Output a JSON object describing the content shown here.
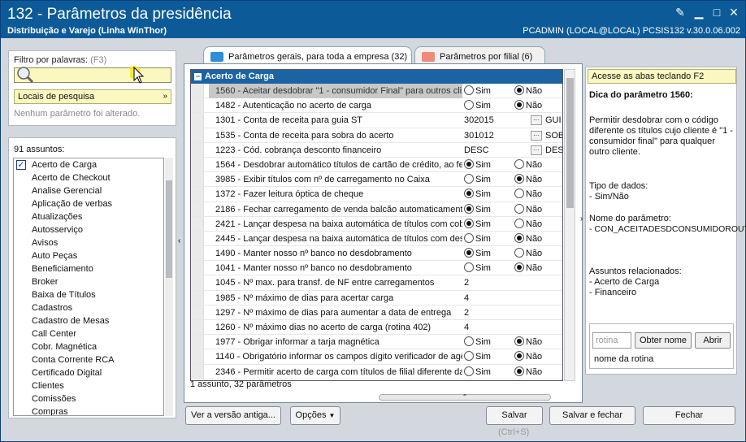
{
  "window": {
    "title": "132 - Parâmetros da presidência",
    "subtitle": "Distribuição e Varejo (Linha WinThor)",
    "userinfo": "PCADMIN (LOCAL@LOCAL)   PCSIS132  v.30.0.06.002"
  },
  "filter": {
    "label": "Filtro por palavras:",
    "hint": "(F3)",
    "search_value": "",
    "locais_label": "Locais de pesquisa",
    "no_change": "Nenhum parâmetro foi alterado."
  },
  "subjects": {
    "count_label": "91 assuntos:",
    "items": [
      "Acerto de Carga",
      "Acerto de Checkout",
      "Analise Gerencial",
      "Aplicação de verbas",
      "Atualizações",
      "Autosserviço",
      "Avisos",
      "Auto Peças",
      "Beneficiamento",
      "Broker",
      "Baixa de Títulos",
      "Cadastros",
      "Cadastro de Mesas",
      "Call Center",
      "Cobr. Magnética",
      "Conta Corrente RCA",
      "Certificado Digital",
      "Clientes",
      "Comissões",
      "Compras"
    ]
  },
  "tabs": {
    "general": "Parâmetros gerais, para toda a empresa  (32)",
    "branch": "Parâmetros por filial  (6)"
  },
  "grid": {
    "group": "Acerto de Carga",
    "rows": [
      {
        "label": "1560 - Aceitar desdobrar \"1 - consumidor Final\" para outros cli",
        "type": "radio",
        "value": "Não",
        "sel": true
      },
      {
        "label": "1482 - Autenticação no acerto de carga",
        "type": "radio",
        "value": "Não"
      },
      {
        "label": "1301 - Conta de receita para guia ST",
        "type": "lookup",
        "code": "302015",
        "desc": "GUI"
      },
      {
        "label": "1535 - Conta de receita para sobra do acerto",
        "type": "lookup",
        "code": "301012",
        "desc": "SOB"
      },
      {
        "label": "1223 - Cód. cobrança desconto financeiro",
        "type": "lookup",
        "code": "DESC",
        "desc": "DES"
      },
      {
        "label": "1564 - Desdobrar automático títulos de cartão de crédito, ao fe",
        "type": "radio",
        "value": "Sim"
      },
      {
        "label": "3985 - Exibir títulos com nº de carregamento no Caixa",
        "type": "radio",
        "value": "Não"
      },
      {
        "label": "1372 - Fazer leitura óptica de cheque",
        "type": "radio",
        "value": "Sim"
      },
      {
        "label": "2186 - Fechar carregamento de venda balcão automaticamente",
        "type": "radio",
        "value": "Sim"
      },
      {
        "label": "2421 - Lançar despesa na baixa automática de títulos com cobra",
        "type": "radio",
        "value": "Sim"
      },
      {
        "label": "2445 - Lançar despesa na baixa automática de títulos com desc",
        "type": "radio",
        "value": "Não"
      },
      {
        "label": "1490 - Manter nosso nº banco no desdobramento",
        "type": "radio",
        "value": "Sim"
      },
      {
        "label": "1041 - Manter nosso nº banco no desdobramento",
        "type": "radio",
        "value": "Não"
      },
      {
        "label": "1045 - Nº max. para transf. de NF entre carregamentos",
        "type": "text",
        "value": "2"
      },
      {
        "label": "1985 - Nº máximo de dias para acertar carga",
        "type": "text",
        "value": "4"
      },
      {
        "label": "1297 - Nº máximo de dias para aumentar a data de entrega",
        "type": "text",
        "value": "2"
      },
      {
        "label": "1260 - Nº máximo dias no acerto de carga (rotina 402)",
        "type": "text",
        "value": "4"
      },
      {
        "label": "1977 - Obrigar informar a tarja magnética",
        "type": "radio",
        "value": "Não"
      },
      {
        "label": "1140 - Obrigatório informar os campos dígito verificador de agê",
        "type": "radio",
        "value": "Não"
      },
      {
        "label": "2346 - Permitir acerto de carga com títulos de filial diferente da",
        "type": "radio",
        "value": "Não"
      }
    ],
    "yes": "Sim",
    "no": "Não",
    "status": "1 assunto, 32 parâmetros"
  },
  "tip": {
    "shortcut": "Acesse as abas teclando F2",
    "title": "Dica do parâmetro 1560:",
    "desc": "Permitir desdobrar com o código diferente os títulos cujo cliente é \"1 - consumidor final\" para qualquer outro cliente.",
    "type_label": "Tipo de dados:",
    "type_value": " - Sim/Não",
    "name_label": "Nome do parâmetro:",
    "name_value": " - CON_ACEITADESDCONSUMIDOROUT",
    "related_label": "Assuntos relacionados:",
    "related": [
      " - Acerto de Carga",
      " - Financeiro"
    ],
    "rotina_placeholder": "rotina",
    "obter_nome": "Obter nome",
    "abrir": "Abrir",
    "rotina_label": "nome da rotina"
  },
  "buttons": {
    "old_version": "Ver a versão antiga...",
    "options": "Opções",
    "save": "Salvar",
    "save_hint": "(Ctrl+S)",
    "save_close": "Salvar e fechar",
    "close": "Fechar"
  },
  "colors": {
    "titlebar": "#0c5b98",
    "group_header": "#1c63a2",
    "highlight": "#fbf8bf"
  }
}
